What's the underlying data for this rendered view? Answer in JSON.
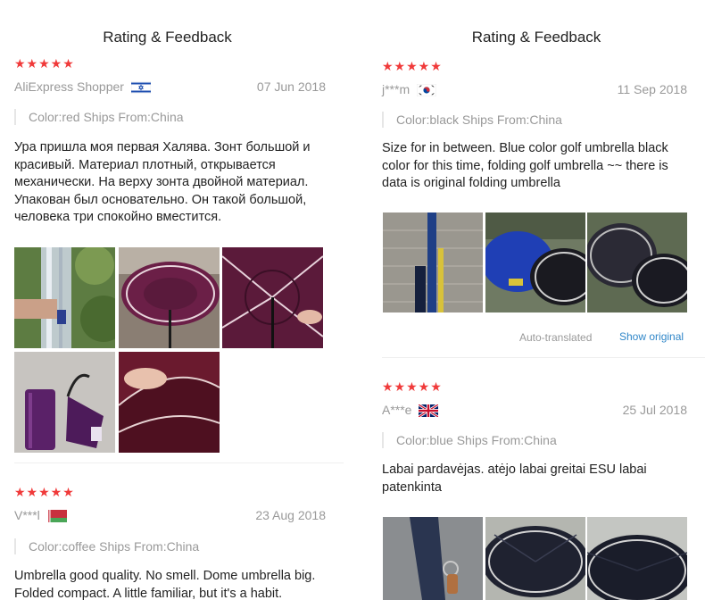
{
  "left": {
    "header": "Rating & Feedback",
    "reviews": [
      {
        "stars": "★★★★★",
        "user": "AliExpress Shopper",
        "flag": "israel-flag-icon",
        "date": "07 Jun 2018",
        "sku": "Color:red Ships From:China",
        "text": "Ура пришла моя первая Халява. Зонт большой и красивый. Материал плотный, открывается механически. На верху зонта двойной материал. Упакован был основательно. Он такой большой, человека три спокойно вместится."
      },
      {
        "stars": "★★★★★",
        "user": "V***l",
        "flag": "belarus-flag-icon",
        "date": "23 Aug 2018",
        "sku": "Color:coffee Ships From:China",
        "text": "Umbrella good quality. No smell. Dome umbrella big. Folded compact. A little familiar, but it's a habit."
      }
    ]
  },
  "right": {
    "header": "Rating & Feedback",
    "reviews": [
      {
        "stars": "★★★★★",
        "user": "j***m",
        "flag": "south-korea-flag-icon",
        "date": "11 Sep 2018",
        "sku": "Color:black Ships From:China",
        "text": "Size for in between. Blue color golf umbrella black color for this time, folding golf umbrella ~~ there is data is original folding umbrella",
        "auto_translated": "Auto-translated",
        "show_original": "Show original"
      },
      {
        "stars": "★★★★★",
        "user": "A***e",
        "flag": "uk-flag-icon",
        "date": "25 Jul 2018",
        "sku": "Color:blue Ships From:China",
        "text": "Labai pardavėjas. atėjo labai greitai ESU labai patenkinta"
      }
    ]
  }
}
